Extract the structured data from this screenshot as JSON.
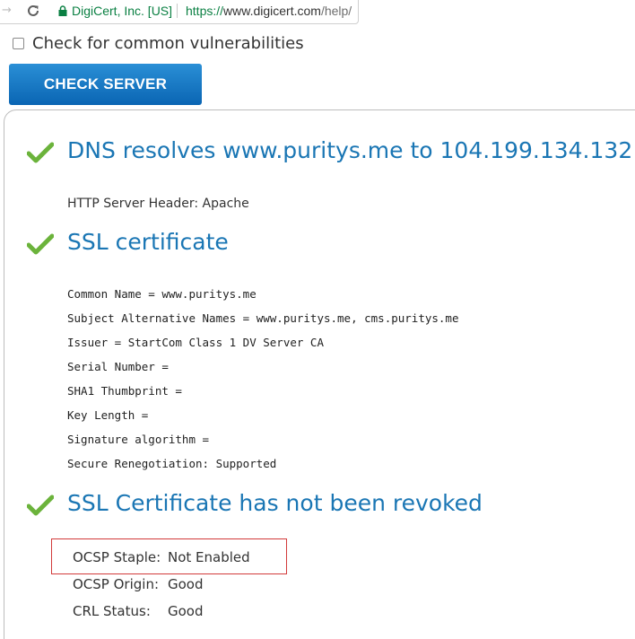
{
  "browser": {
    "site_identity": "DigiCert, Inc. [US]",
    "url_scheme": "https://",
    "url_host": "www.digicert.com",
    "url_path": "/help/"
  },
  "form": {
    "vuln_check_label": "Check for common vulnerabilities",
    "vuln_checked": false,
    "check_button_label": "CHECK SERVER"
  },
  "results": {
    "dns": {
      "heading": "DNS resolves www.puritys.me to 104.199.134.132",
      "server_header": "HTTP Server Header: Apache"
    },
    "certificate": {
      "heading": "SSL certificate",
      "lines": [
        "Common Name = www.puritys.me",
        "Subject Alternative Names = www.puritys.me, cms.puritys.me",
        "Issuer = StartCom Class 1 DV Server CA",
        "Serial Number =",
        "SHA1 Thumbprint =",
        "Key Length =",
        "Signature algorithm =",
        "Secure Renegotiation: Supported"
      ]
    },
    "revocation": {
      "heading": "SSL Certificate has not been revoked",
      "rows": [
        {
          "label": "OCSP Staple:",
          "value": "Not Enabled"
        },
        {
          "label": "OCSP Origin:",
          "value": "Good"
        },
        {
          "label": "CRL Status:",
          "value": "Good"
        }
      ]
    }
  },
  "colors": {
    "heading_blue": "#1a76b4",
    "check_green": "#6bb33b",
    "button_blue": "#0a65b3",
    "highlight_red": "#d23a3a"
  }
}
